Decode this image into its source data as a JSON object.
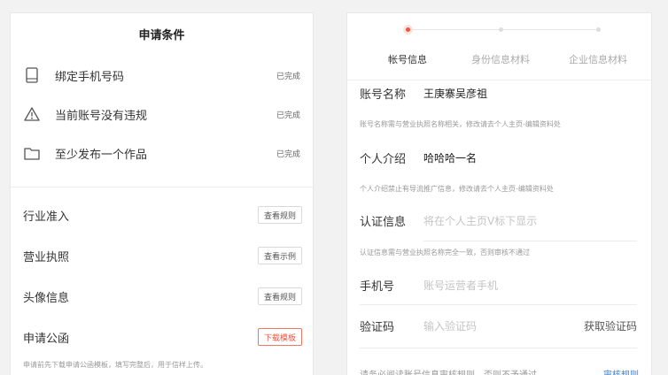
{
  "left": {
    "title": "申请条件",
    "conditions": [
      {
        "label": "绑定手机号码",
        "status": "已完成",
        "icon": "phone-icon"
      },
      {
        "label": "当前账号没有违规",
        "status": "已完成",
        "icon": "warning-icon"
      },
      {
        "label": "至少发布一个作品",
        "status": "已完成",
        "icon": "folder-icon"
      }
    ],
    "items": [
      {
        "label": "行业准入",
        "button": "查看规则"
      },
      {
        "label": "营业执照",
        "button": "查看示例"
      },
      {
        "label": "头像信息",
        "button": "查看规则"
      },
      {
        "label": "申请公函",
        "button": "下载模板"
      }
    ],
    "note": "申请前先下载申请公函模板，填写完整后，用于信样上传。"
  },
  "right": {
    "steps": [
      "帐号信息",
      "身份信息材料",
      "企业信息材料"
    ],
    "account_name": {
      "label": "账号名称",
      "value": "王庚寨吴彦祖",
      "hint": "账号名称需与营业执照名称相关，修改请去个人主页-编辑资料处"
    },
    "intro": {
      "label": "个人介绍",
      "value": "哈哈哈一名",
      "hint": "个人介绍禁止有导流推广信息，修改请去个人主页-编辑资料处"
    },
    "cert": {
      "label": "认证信息",
      "placeholder": "将在个人主页V标下显示",
      "hint": "认证信息需与营业执照名称完全一致，否则审核不通过"
    },
    "phone": {
      "label": "手机号",
      "placeholder": "账号运营者手机"
    },
    "code": {
      "label": "验证码",
      "placeholder": "输入验证码",
      "link": "获取验证码"
    },
    "agree_text": "请务必阅读账号信息审核规则，否则不予通过",
    "agree_link": "审核规则"
  },
  "colors": {
    "accent": "#ee5541",
    "link": "#3a7fd5"
  }
}
